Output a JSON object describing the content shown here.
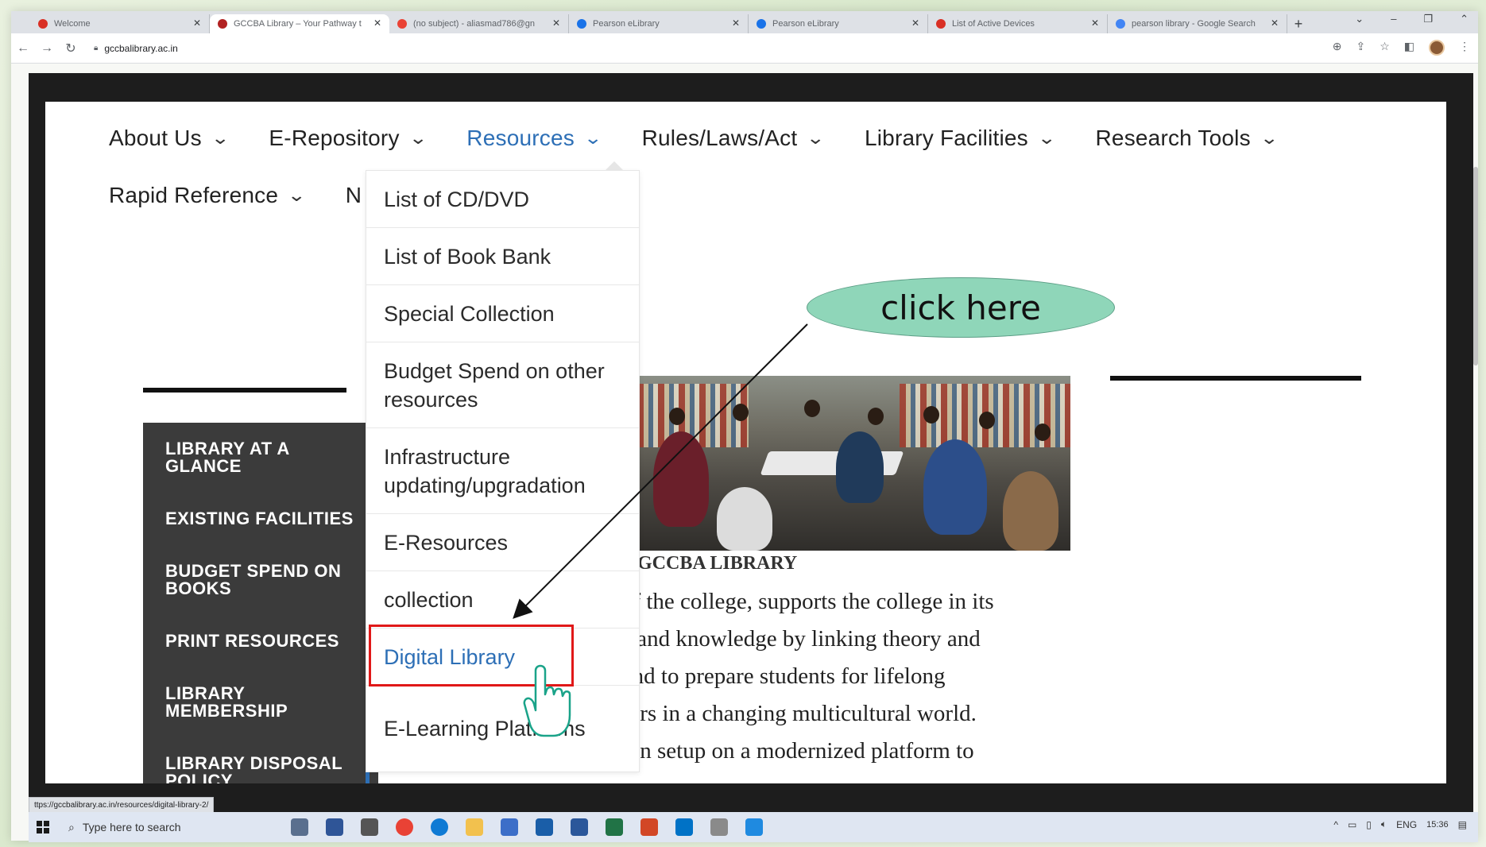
{
  "browser": {
    "tabs": [
      {
        "label": "Welcome",
        "favicon_color": "#d93025",
        "active": false
      },
      {
        "label": "GCCBA Library – Your Pathway t",
        "favicon_color": "#b22222",
        "active": true
      },
      {
        "label": "(no subject) - aliasmad786@gn",
        "favicon_color": "#ea4335",
        "active": false
      },
      {
        "label": "Pearson eLibrary",
        "favicon_color": "#1a73e8",
        "active": false
      },
      {
        "label": "Pearson eLibrary",
        "favicon_color": "#1a73e8",
        "active": false
      },
      {
        "label": "List of Active Devices",
        "favicon_color": "#d93025",
        "active": false
      },
      {
        "label": "pearson library - Google Search",
        "favicon_color": "#4285f4",
        "active": false
      }
    ],
    "tab_close": "✕",
    "new_tab": "+",
    "address": "gccbalibrary.ac.in"
  },
  "site": {
    "menu_row1": [
      {
        "label": "About Us",
        "active": false
      },
      {
        "label": "E-Repository",
        "active": false
      },
      {
        "label": "Resources",
        "active": true
      },
      {
        "label": "Rules/Laws/Act",
        "active": false
      },
      {
        "label": "Library Facilities",
        "active": false
      },
      {
        "label": "Research Tools",
        "active": false
      }
    ],
    "menu_row2": [
      {
        "label": "Rapid Reference",
        "active": false
      },
      {
        "label": "N",
        "active": false
      }
    ],
    "dropdown": [
      {
        "label": "List of CD/DVD"
      },
      {
        "label": "List of Book Bank"
      },
      {
        "label": "Special Collection"
      },
      {
        "label": "Budget Spend on other resources"
      },
      {
        "label": "Infrastructure updating/upgradation"
      },
      {
        "label": "E-Resources"
      },
      {
        "label": "collection"
      },
      {
        "label": "Digital Library"
      },
      {
        "label": "E-Learning Platforms"
      }
    ],
    "sidebar": [
      "LIBRARY AT A GLANCE",
      "EXISTING FACILITIES",
      "BUDGET SPEND ON BOOKS",
      "PRINT RESOURCES",
      "LIBRARY MEMBERSHIP",
      "LIBRARY DISPOSAL POLICY"
    ],
    "caption": "GCCBA LIBRARY",
    "paragraph_lines": [
      "rt of the college, supports the college in its",
      "ing and knowledge by linking theory and",
      "s, and to prepare students for lifelong",
      "areers in a changing multicultural world.",
      "The GCCBA Library has been setup on a modernized platform to"
    ]
  },
  "annotation": {
    "callout_text": "click here",
    "highlight_color": "#e01818",
    "callout_color": "#8fd6b9"
  },
  "status_url": "ttps://gccbalibrary.ac.in/resources/digital-library-2/",
  "taskbar": {
    "search_placeholder": "Type here to search",
    "language": "ENG",
    "time": "15:36"
  },
  "colors": {
    "link_blue": "#2d6fb6",
    "sidebar_bg": "#3b3b3b"
  }
}
